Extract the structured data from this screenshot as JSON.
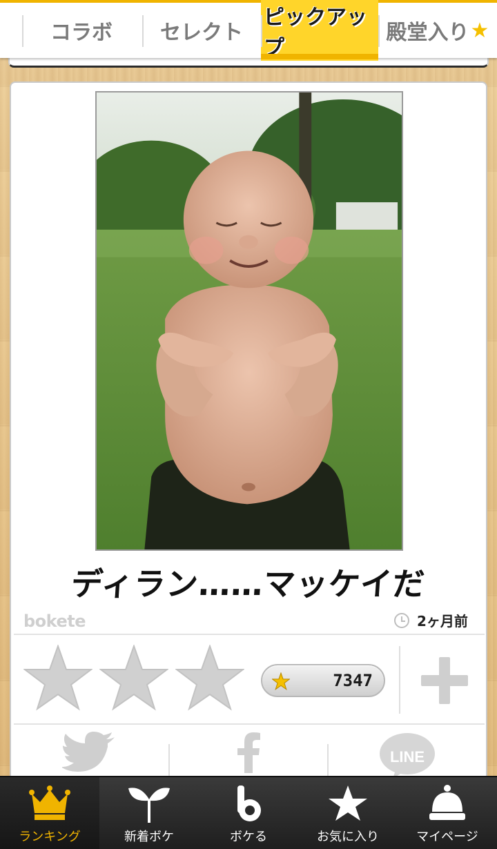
{
  "tabs": [
    {
      "label": "コラボ",
      "active": false
    },
    {
      "label": "セレクト",
      "active": false
    },
    {
      "label": "ピックアップ",
      "active": true
    },
    {
      "label": "殿堂入り",
      "suffix": "★",
      "active": false
    }
  ],
  "post": {
    "caption": "ディラン……マッケイだ",
    "logo": "bokete",
    "posted_ago": "2ヶ月前",
    "score": "7347",
    "rating_stars_filled": 0,
    "rating_stars_total": 3
  },
  "share": [
    {
      "icon": "twitter-icon"
    },
    {
      "icon": "facebook-icon"
    },
    {
      "icon": "line-icon",
      "text": "LINE"
    }
  ],
  "bottom_nav": [
    {
      "label": "ランキング",
      "icon": "crown-icon",
      "active": true
    },
    {
      "label": "新着ボケ",
      "icon": "sprout-icon",
      "active": false
    },
    {
      "label": "ボケる",
      "icon": "bokete-b-icon",
      "active": false
    },
    {
      "label": "お気に入り",
      "icon": "star-icon",
      "active": false
    },
    {
      "label": "マイページ",
      "icon": "bell-person-icon",
      "active": false
    }
  ],
  "colors": {
    "accent": "#f0b400",
    "tab_highlight": "#ffd52a",
    "inactive_icon": "#cfcfcf"
  }
}
